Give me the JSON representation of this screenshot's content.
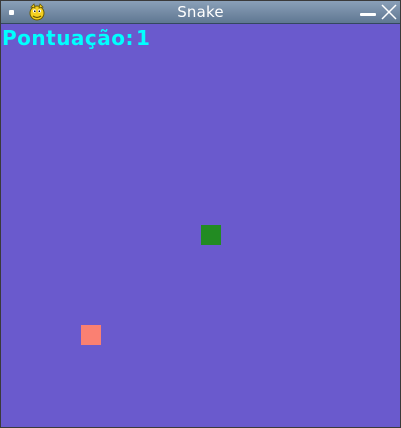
{
  "window": {
    "title": "Snake",
    "icon": "pygame-snake-icon"
  },
  "hud": {
    "score_label": "Pontuação:",
    "score_value": "1"
  },
  "game": {
    "grid_size": 20,
    "snake": [
      {
        "col": 10,
        "row": 10
      }
    ],
    "food": {
      "col": 4,
      "row": 15
    },
    "colors": {
      "background": "#6a5acd",
      "snake": "#228b22",
      "food": "#fa8072",
      "score_text": "#00ffff"
    }
  }
}
